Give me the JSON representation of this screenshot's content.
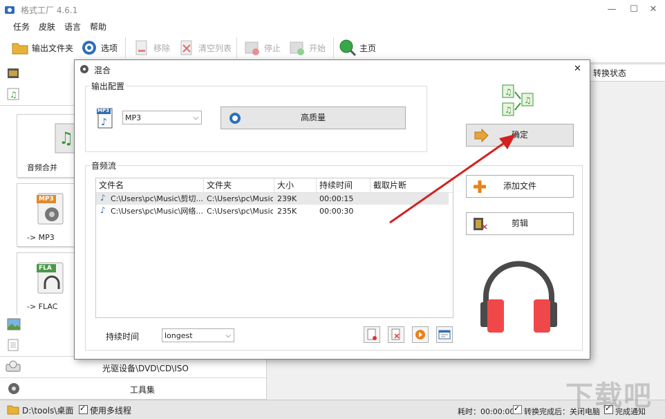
{
  "app": {
    "title": "格式工厂 4.6.1"
  },
  "window_controls": {
    "minimize": "—",
    "maximize": "☐",
    "close": "✕"
  },
  "menu": [
    "任务",
    "皮肤",
    "语言",
    "帮助"
  ],
  "toolbar": {
    "output_folder": "输出文件夹",
    "options": "选项",
    "remove": "移除",
    "clear_list": "清空列表",
    "stop": "停止",
    "start": "开始",
    "home": "主页"
  },
  "left_panel": {
    "tiles": [
      {
        "label": "音频合并"
      },
      {
        "label": "-> MP3",
        "badge": "MP3"
      },
      {
        "label": "-> FLAC",
        "badge": "FLA"
      }
    ],
    "categories": [
      "光驱设备\\DVD\\CD\\ISO",
      "工具集"
    ]
  },
  "right_panel": {
    "header": "转换状态"
  },
  "dialog": {
    "title": "混合",
    "close": "✕",
    "output_config": {
      "label": "输出配置",
      "format_icon_badge": "MP3",
      "format": "MP3",
      "quality": "高质量"
    },
    "audio_stream": {
      "label": "音频流",
      "columns": [
        "文件名",
        "文件夹",
        "大小",
        "持续时间",
        "截取片断"
      ],
      "rows": [
        [
          "C:\\Users\\pc\\Music\\剪切...",
          "C:\\Users\\pc\\Music",
          "239K",
          "00:00:15",
          ""
        ],
        [
          "C:\\Users\\pc\\Music\\网络...",
          "C:\\Users\\pc\\Music",
          "235K",
          "00:00:30",
          ""
        ]
      ]
    },
    "duration": {
      "label": "持续时间",
      "value": "longest"
    },
    "buttons": {
      "ok": "确定",
      "add_file": "添加文件",
      "clip": "剪辑"
    }
  },
  "statusbar": {
    "path": "D:\\tools\\桌面",
    "multithread": "使用多线程",
    "elapsed": "耗时：00:00:00",
    "after_convert": "转换完成后：关闭电脑",
    "notify": "完成通知"
  },
  "watermark": "下载吧",
  "colors": {
    "arrow": "#d42020",
    "headphone_cup": "#f04848",
    "headphone_band": "#4a4a4a"
  }
}
